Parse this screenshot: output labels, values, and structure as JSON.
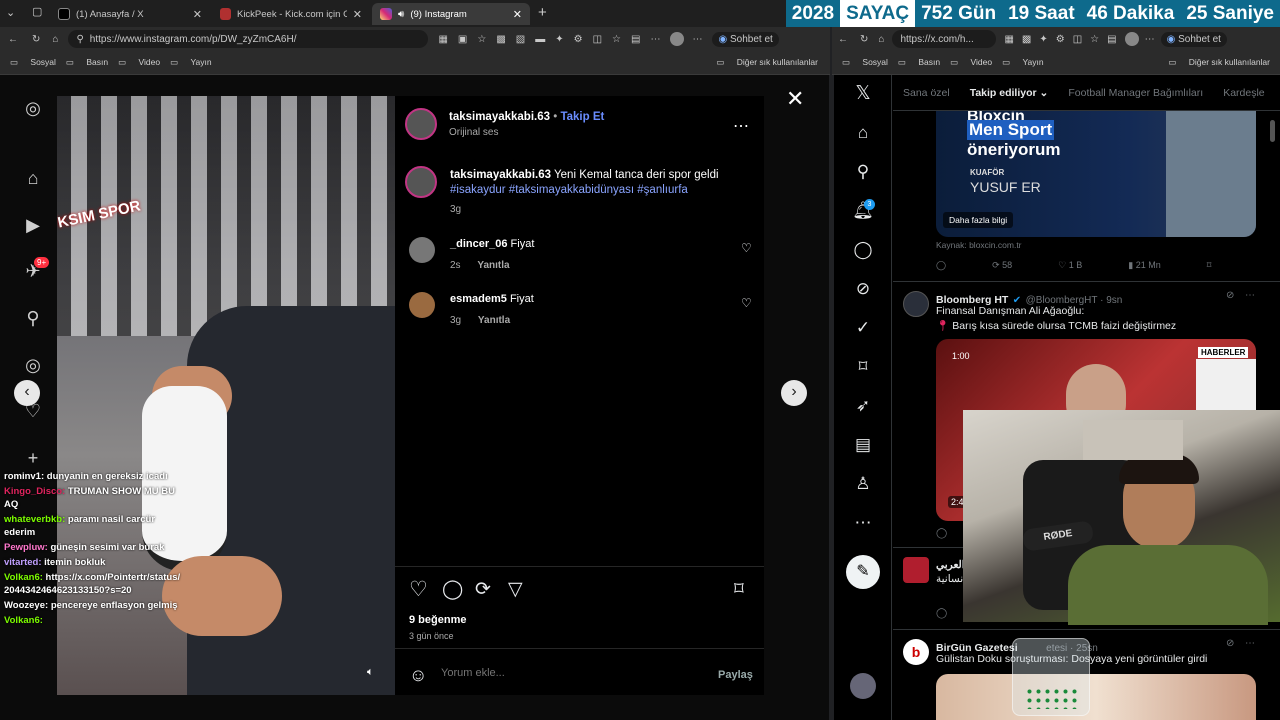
{
  "tabs": [
    {
      "label": "(1) Anasayfa / X"
    },
    {
      "label": "KickPeek - Kick.com için Gerçek Za"
    },
    {
      "label": "(9) Instagram"
    }
  ],
  "timer": {
    "year": "2028",
    "label": "SAYAÇ",
    "days": "752 Gün",
    "hours": "19 Saat",
    "minutes": "46 Dakika",
    "seconds": "25 Saniye"
  },
  "left_browser": {
    "url": "https://www.instagram.com/p/DW_zyZmCA6H/",
    "copilot": "Sohbet et",
    "bookmarks": [
      "Sosyal",
      "Basın",
      "Video",
      "Yayın"
    ],
    "other_bookmarks": "Diğer sık kullanılanlar"
  },
  "right_browser": {
    "url": "https://x.com/h...",
    "copilot": "Sohbet et",
    "bookmarks": [
      "Sosyal",
      "Basın",
      "Video",
      "Yayın"
    ],
    "other_bookmarks": "Diğer sık kullanılanlar"
  },
  "instagram": {
    "sidebar_badge": "9+",
    "shoe_sign": "KSIM SPOR",
    "post": {
      "username": "taksimayakkabi.63",
      "follow": "Takip Et",
      "audio": "Orijinal ses",
      "caption_user": "taksimayakkabi.63",
      "caption": "Yeni Kemal tanca deri spor geldi",
      "hashtags": "#isakaydur #taksimayakkabidünyası #şanlıurfa",
      "caption_age": "3g",
      "likes": "9 beğenme",
      "date": "3 gün önce",
      "comment_placeholder": "Yorum ekle...",
      "share": "Paylaş"
    },
    "comments": [
      {
        "user": "_dincer_06",
        "text": "Fiyat",
        "age": "2s",
        "reply": "Yanıtla"
      },
      {
        "user": "esmadem5",
        "text": "Fiyat",
        "age": "3g",
        "reply": "Yanıtla"
      }
    ]
  },
  "chat": [
    {
      "user": "rominv1:",
      "text": "dunyanin en gereksiz icadı",
      "color": "#ffffff"
    },
    {
      "user": "Kingo_Disco:",
      "text": "TRUMAN SHOW MU BU AQ",
      "color": "#e0245e"
    },
    {
      "user": "whateverbkb:",
      "text": "paramı nasil carcür ederim",
      "color": "#7cfc00"
    },
    {
      "user": "Pewpluw:",
      "text": "güneşin sesimi var burak",
      "color": "#ff77cc"
    },
    {
      "user": "vitarted:",
      "text": "itemin bokluk",
      "color": "#c0a0ff"
    },
    {
      "user": "Volkan6:",
      "text": "https://x.com/Pointertr/status/2044342464623133150?s=20",
      "color": "#7cfc00"
    },
    {
      "user": "Woozeye:",
      "text": "pencereye enflasyon gelmiş",
      "color": "#ffffff"
    },
    {
      "user": "Volkan6:",
      "text": "",
      "color": "#7cfc00"
    }
  ],
  "twitter": {
    "tabs": [
      "Sana özel",
      "Takip ediliyor",
      "Football Manager Bağımlıları",
      "Kardeşle"
    ],
    "ad": {
      "headline1": "Bloxcin",
      "headline2": "Men Sport",
      "headline3": "öneriyorum",
      "role": "KUAFÖR",
      "name": "YUSUF ER",
      "cta": "Daha fazla bilgi",
      "source": "Kaynak: bloxcin.com.tr",
      "retweets": "58",
      "likes": "1 B",
      "views": "21 Mn"
    },
    "notif_badge": "3",
    "tweet1": {
      "name": "Bloomberg HT",
      "handle": "@BloombergHT · 9sn",
      "line1": "Finansal Danışman Ali Ağaoğlu:",
      "line2": "Barış kısa sürede olursa TCMB faizi değiştirmez",
      "video_time": "1:00",
      "video_badge": "HABERLER",
      "media_time": "2:4"
    },
    "tweet2": {
      "name": "العربي",
      "text": "إنسانية"
    },
    "tweet3": {
      "name": "BirGün Gazetesi",
      "handle": "etesi · 25sn",
      "text": "Gülistan Doku soruşturması: Dosyaya yeni görüntüler girdi"
    }
  },
  "webcam": {
    "mic": "RØDE"
  }
}
